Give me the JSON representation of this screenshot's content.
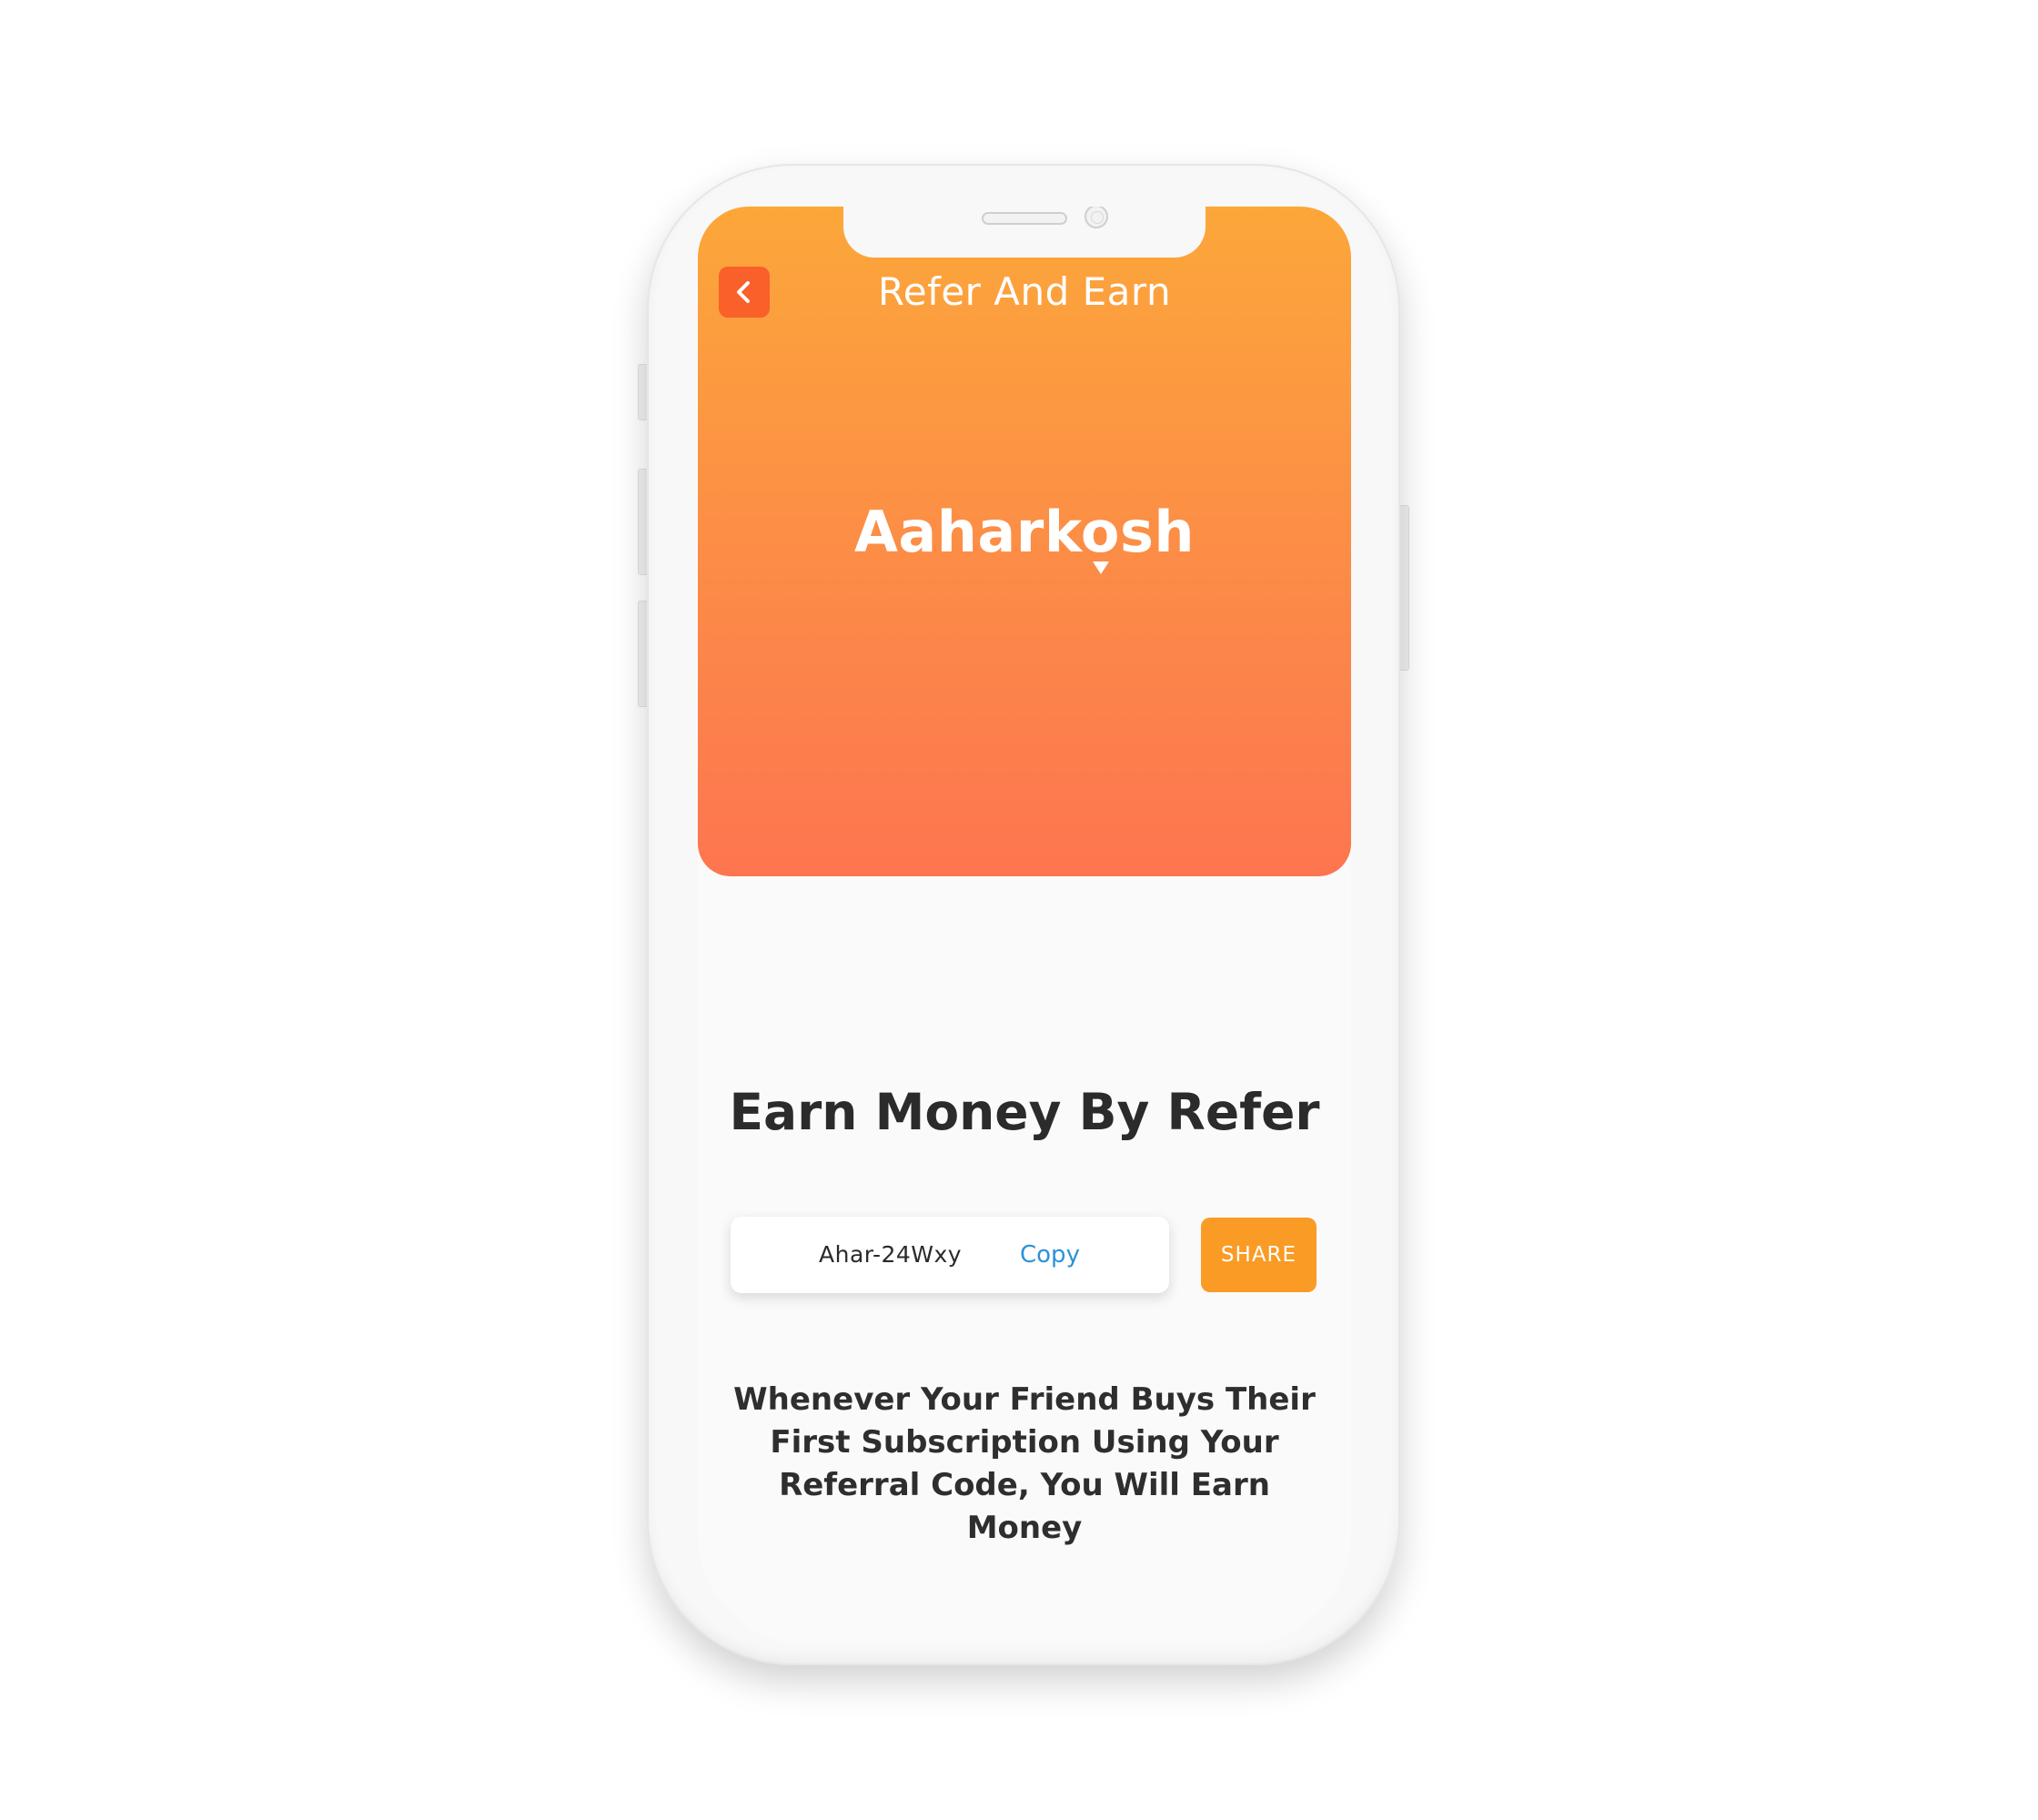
{
  "header": {
    "title": "Refer And Earn"
  },
  "brand": {
    "logo_text": "Aaharkosh"
  },
  "main": {
    "headline": "Earn Money By Refer",
    "referral_code": "Ahar-24Wxy",
    "copy_label": "Copy",
    "share_label": "SHARE",
    "description": "Whenever Your Friend Buys Their First Subscription Using Your Referral Code, You Will Earn Money"
  },
  "icons": {
    "back": "chevron-left-icon",
    "logo_pin": "location-pin-icon"
  },
  "colors": {
    "header_gradient_top": "#fca73a",
    "header_gradient_bottom": "#fd7550",
    "back_button": "#f9602a",
    "share_button": "#fa9b25",
    "copy_link": "#2b92d9",
    "text_dark": "#2b2b2b"
  }
}
